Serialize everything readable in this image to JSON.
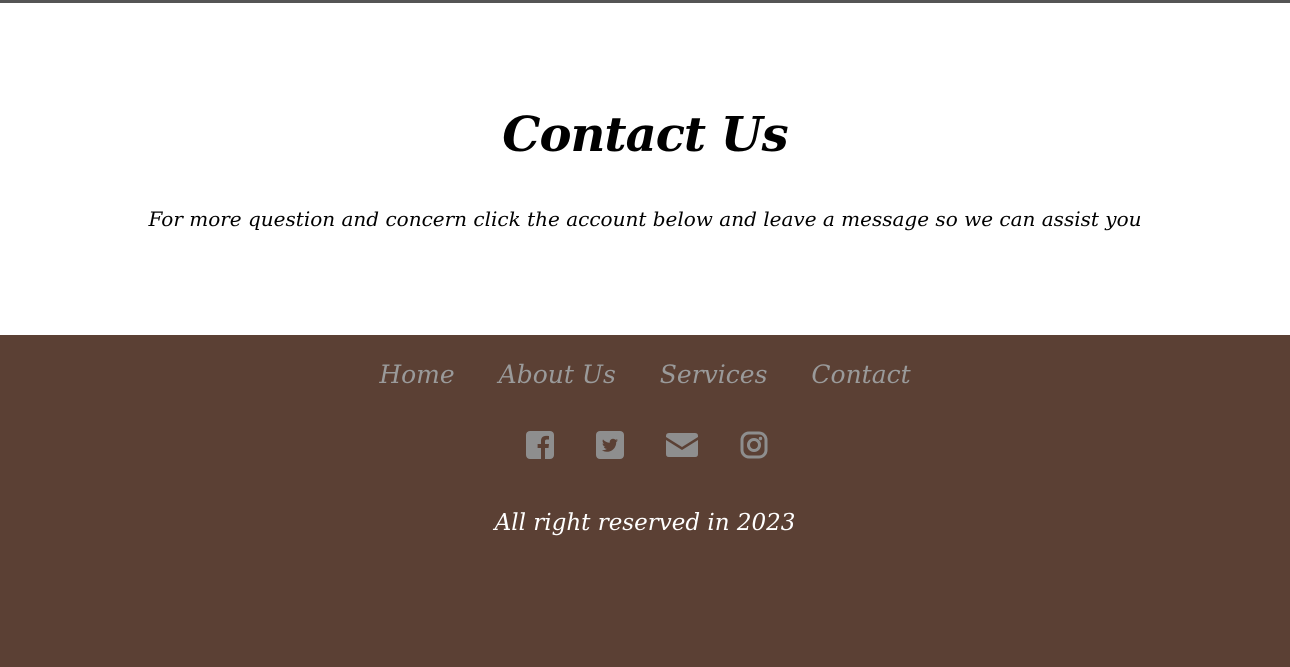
{
  "contact": {
    "title": "Contact Us",
    "text": "For more question and concern click the account below and leave a message so we can assist you"
  },
  "footer": {
    "nav": [
      {
        "label": "Home"
      },
      {
        "label": "About Us"
      },
      {
        "label": "Services"
      },
      {
        "label": "Contact"
      }
    ],
    "social": [
      {
        "icon": "facebook-icon"
      },
      {
        "icon": "twitter-icon"
      },
      {
        "icon": "envelope-icon"
      },
      {
        "icon": "instagram-icon"
      }
    ],
    "copyright": "All right reserved in 2023"
  },
  "colors": {
    "footer_bg": "#5b4034",
    "nav_link": "#9a9a9a",
    "icon": "#8e8e8e",
    "copyright": "#ffffff"
  }
}
